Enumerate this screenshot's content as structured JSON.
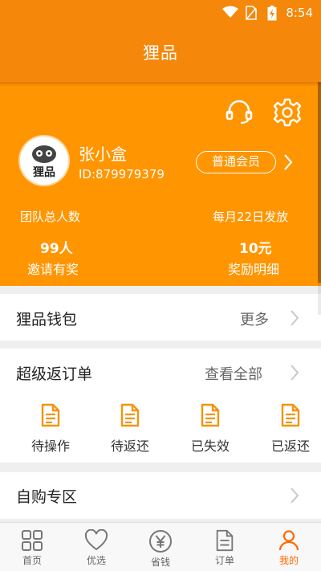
{
  "status_bar": {
    "time": "8:54"
  },
  "header": {
    "title": "狸品"
  },
  "profile": {
    "name": "张小盒",
    "id_text": "ID:879979379",
    "avatar_text": "狸品",
    "member_level": "普通会员",
    "stats": {
      "team_label": "团队总人数",
      "payout_label": "每月22日发放",
      "team_count": "99人",
      "reward_amount": "10元",
      "invite_link": "邀请有奖",
      "reward_detail_link": "奖励明细"
    }
  },
  "wallet": {
    "title": "狸品钱包",
    "more": "更多"
  },
  "orders": {
    "title": "超级返订单",
    "more": "查看全部",
    "statuses": [
      "待操作",
      "待返还",
      "已失效",
      "已返还"
    ]
  },
  "self_buy": {
    "title": "自购专区"
  },
  "tabbar": {
    "items": [
      "首页",
      "优选",
      "省钱",
      "订单",
      "我的"
    ],
    "active_index": 4
  },
  "colors": {
    "header": "#f5870a",
    "profile_bg": "#ff9500",
    "accent": "#f5930c",
    "tab_active": "#ff6a00"
  }
}
